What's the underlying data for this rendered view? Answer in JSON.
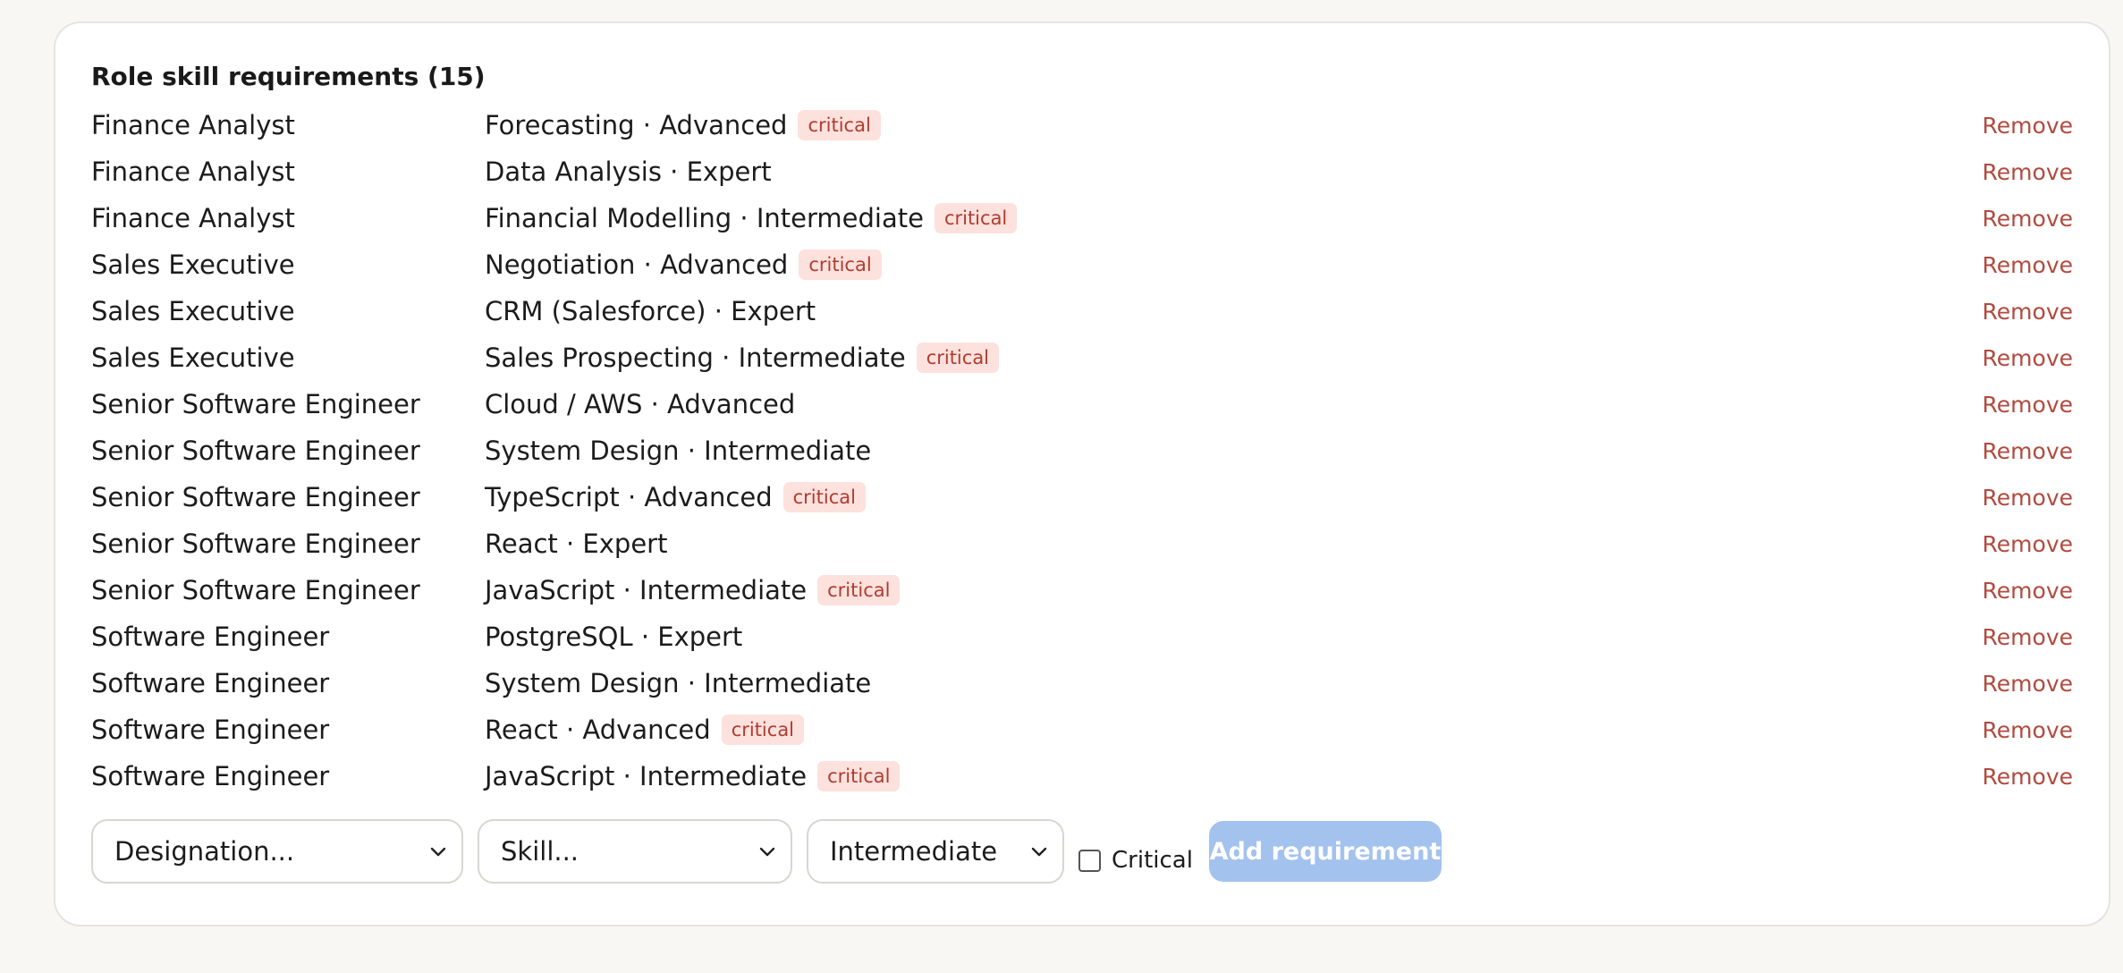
{
  "card": {
    "title": "Role skill requirements (15)"
  },
  "requirements": [
    {
      "designation": "Finance Analyst",
      "skill": "Forecasting · Advanced",
      "critical": true
    },
    {
      "designation": "Finance Analyst",
      "skill": "Data Analysis · Expert",
      "critical": false
    },
    {
      "designation": "Finance Analyst",
      "skill": "Financial Modelling · Intermediate",
      "critical": true
    },
    {
      "designation": "Sales Executive",
      "skill": "Negotiation · Advanced",
      "critical": true
    },
    {
      "designation": "Sales Executive",
      "skill": "CRM (Salesforce) · Expert",
      "critical": false
    },
    {
      "designation": "Sales Executive",
      "skill": "Sales Prospecting · Intermediate",
      "critical": true
    },
    {
      "designation": "Senior Software Engineer",
      "skill": "Cloud / AWS · Advanced",
      "critical": false
    },
    {
      "designation": "Senior Software Engineer",
      "skill": "System Design · Intermediate",
      "critical": false
    },
    {
      "designation": "Senior Software Engineer",
      "skill": "TypeScript · Advanced",
      "critical": true
    },
    {
      "designation": "Senior Software Engineer",
      "skill": "React · Expert",
      "critical": false
    },
    {
      "designation": "Senior Software Engineer",
      "skill": "JavaScript · Intermediate",
      "critical": true
    },
    {
      "designation": "Software Engineer",
      "skill": "PostgreSQL · Expert",
      "critical": false
    },
    {
      "designation": "Software Engineer",
      "skill": "System Design · Intermediate",
      "critical": false
    },
    {
      "designation": "Software Engineer",
      "skill": "React · Advanced",
      "critical": true
    },
    {
      "designation": "Software Engineer",
      "skill": "JavaScript · Intermediate",
      "critical": true
    }
  ],
  "labels": {
    "critical_badge": "critical",
    "remove": "Remove"
  },
  "form": {
    "designation_select": "Designation...",
    "skill_select": "Skill...",
    "level_select": "Intermediate",
    "critical_checkbox_label": "Critical",
    "critical_checked": false,
    "add_button": "Add requirement"
  },
  "colors": {
    "badge_bg": "#fde1dd",
    "badge_text": "#b03c30",
    "remove_link": "#b24a3f",
    "add_button_bg": "#a3c2ee"
  },
  "icons": {
    "select_chevron": "chevron-down-icon"
  }
}
